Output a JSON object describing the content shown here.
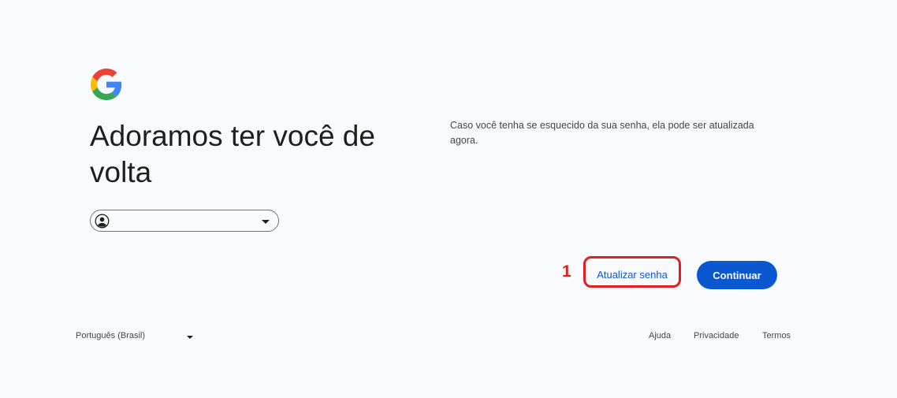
{
  "logo": {
    "icon": "google-g-icon"
  },
  "headline": "Adoramos ter você de volta",
  "account_chip": {
    "avatar_icon": "account-circle-icon",
    "chevron_icon": "chevron-down-icon"
  },
  "description": "Caso você tenha se esquecido da sua senha, ela pode ser atualizada agora.",
  "actions": {
    "update_password_label": "Atualizar senha",
    "continue_label": "Continuar"
  },
  "annotation": {
    "number": "1",
    "color": "#e02020"
  },
  "footer": {
    "language": "Português (Brasil)",
    "links": {
      "help": "Ajuda",
      "privacy": "Privacidade",
      "terms": "Termos"
    }
  },
  "colors": {
    "background": "#f8fafd",
    "primary": "#0b57d0",
    "text": "#1f1f1f"
  }
}
